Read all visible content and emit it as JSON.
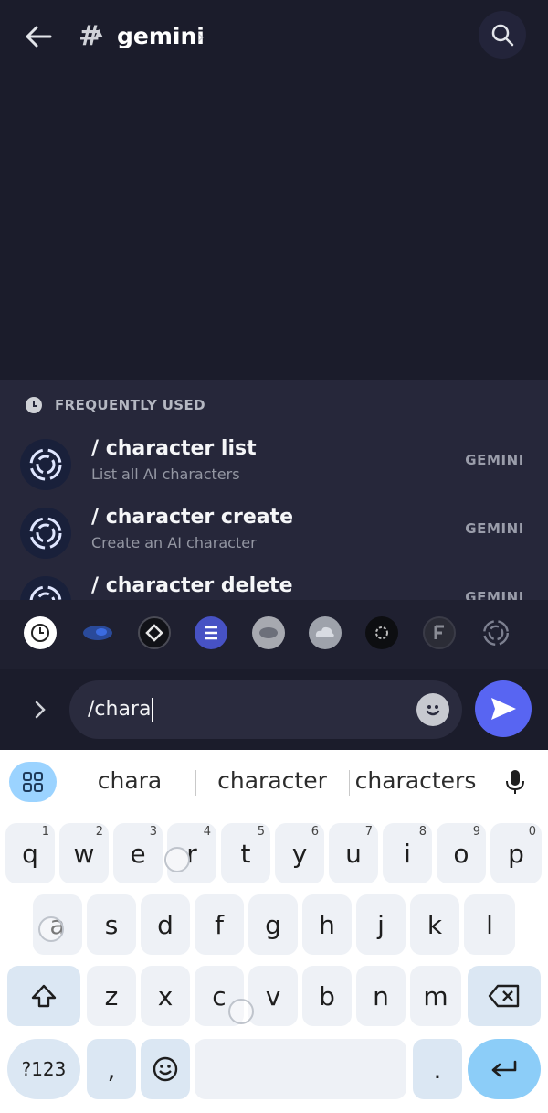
{
  "header": {
    "channel_name": "gemini",
    "hash_symbol": "#",
    "chevron": "›"
  },
  "suggestions": {
    "section_title": "FREQUENTLY USED",
    "commands": [
      {
        "name": "/ character list",
        "description": "List all AI characters",
        "source": "GEMINI"
      },
      {
        "name": "/ character create",
        "description": "Create an AI character",
        "source": "GEMINI"
      },
      {
        "name": "/ character delete",
        "description": "",
        "source": "GEMINI"
      }
    ]
  },
  "input": {
    "value": "/chara"
  },
  "keyboard": {
    "suggestions": [
      "chara",
      "character",
      "characters"
    ],
    "row1": [
      {
        "key": "q",
        "hint": "1"
      },
      {
        "key": "w",
        "hint": "2"
      },
      {
        "key": "e",
        "hint": "3"
      },
      {
        "key": "r",
        "hint": "4"
      },
      {
        "key": "t",
        "hint": "5"
      },
      {
        "key": "y",
        "hint": "6"
      },
      {
        "key": "u",
        "hint": "7"
      },
      {
        "key": "i",
        "hint": "8"
      },
      {
        "key": "o",
        "hint": "9"
      },
      {
        "key": "p",
        "hint": "0"
      }
    ],
    "row2": [
      "a",
      "s",
      "d",
      "f",
      "g",
      "h",
      "j",
      "k",
      "l"
    ],
    "row3": [
      "z",
      "x",
      "c",
      "v",
      "b",
      "n",
      "m"
    ],
    "symbols_label": "?123",
    "comma_label": ",",
    "period_label": "."
  },
  "colors": {
    "background": "#1b1c2b",
    "panel": "#26273a",
    "accent": "#5865f2",
    "keyboard_bg": "#ffffff",
    "key_bg": "#eef1f6"
  }
}
